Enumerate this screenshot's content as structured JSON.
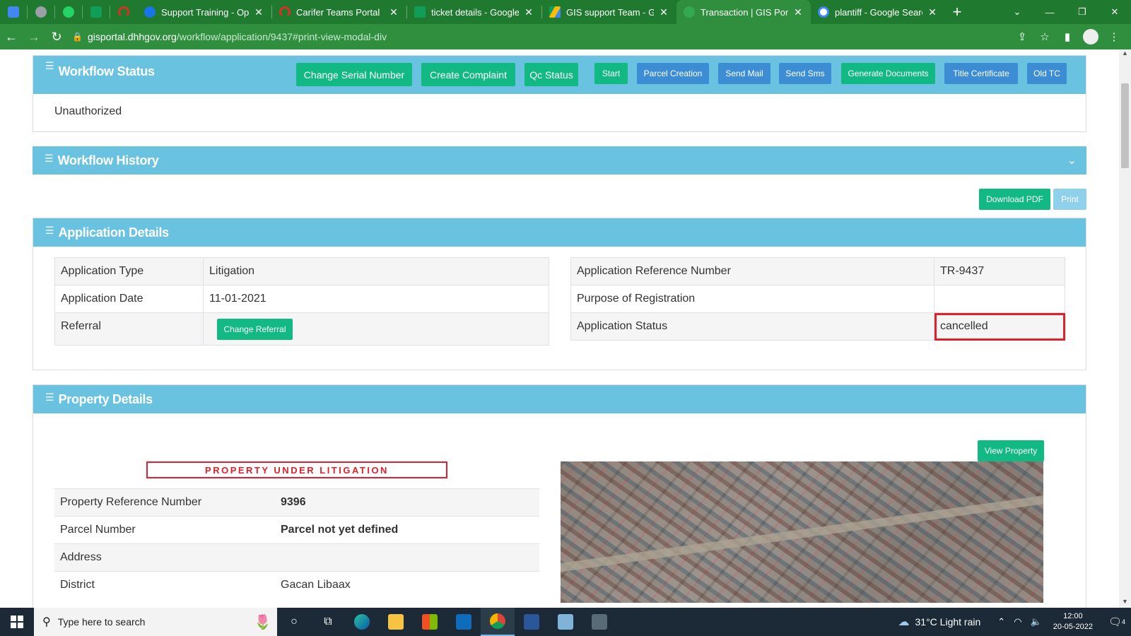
{
  "browser": {
    "pinned_tabs": [
      {
        "icon": "docs-icon",
        "color": "#4285f4"
      },
      {
        "icon": "perplexity-icon",
        "color": "#9aa0a6"
      },
      {
        "icon": "whatsapp-icon",
        "color": "#25d366"
      },
      {
        "icon": "sheets-icon",
        "color": "#0f9d58"
      },
      {
        "icon": "red-arc-icon",
        "color": "#d93025"
      }
    ],
    "tabs": [
      {
        "title": "Support Training - Ope",
        "icon_color": "#1a73e8",
        "active": false
      },
      {
        "title": "Carifer Teams Portal",
        "icon_color": "#d93025",
        "active": false
      },
      {
        "title": "ticket details - Google S",
        "icon_color": "#0f9d58",
        "active": false
      },
      {
        "title": "GIS support Team - Go",
        "icon_color": "#fbbc04",
        "active": false
      },
      {
        "title": "Transaction | GIS Portal",
        "icon_color": "#34a853",
        "active": true
      },
      {
        "title": "plantiff - Google Search",
        "icon_color": "#4285f4",
        "active": false
      }
    ],
    "close_glyph": "✕",
    "new_tab": "+",
    "url_host": "gisportal.dhhgov.org",
    "url_path": "/workflow/application/9437#print-view-modal-div"
  },
  "workflow_status": {
    "title": "Workflow Status",
    "status": "Unauthorized",
    "buttons": [
      {
        "label": "Change Serial Number",
        "color": "green"
      },
      {
        "label": "Create Complaint",
        "color": "green"
      },
      {
        "label": "Qc Status",
        "color": "green"
      },
      {
        "label": "Start",
        "color": "green"
      },
      {
        "label": "Parcel Creation",
        "color": "blue"
      },
      {
        "label": "Send Mail",
        "color": "blue"
      },
      {
        "label": "Send Sms",
        "color": "blue"
      },
      {
        "label": "Generate Documents",
        "color": "green"
      },
      {
        "label": "Title Certificate",
        "color": "blue"
      },
      {
        "label": "Old TC",
        "color": "blue"
      }
    ]
  },
  "workflow_history": {
    "title": "Workflow History"
  },
  "toolbar": {
    "download_pdf": "Download PDF",
    "print": "Print"
  },
  "application_details": {
    "title": "Application Details",
    "left": [
      {
        "label": "Application Type",
        "value": "Litigation"
      },
      {
        "label": "Application Date",
        "value": "11-01-2021"
      },
      {
        "label": "Referral",
        "button": "Change Referral"
      }
    ],
    "right": [
      {
        "label": "Application Reference Number",
        "value": "TR-9437"
      },
      {
        "label": "Purpose of Registration",
        "value": ""
      },
      {
        "label": "Application Status",
        "value": "cancelled"
      }
    ]
  },
  "property_details": {
    "title": "Property Details",
    "view_property": "View Property",
    "litigation_banner": "PROPERTY UNDER LITIGATION",
    "rows": [
      {
        "label": "Property Reference Number",
        "value": "9396"
      },
      {
        "label": "Parcel Number",
        "value": "Parcel not yet defined"
      },
      {
        "label": "Address",
        "value": ""
      },
      {
        "label": "District",
        "value": "Gacan Libaax"
      }
    ]
  },
  "taskbar": {
    "search_placeholder": "Type here to search",
    "weather": "31°C  Light rain",
    "time": "12:00",
    "date": "20-05-2022",
    "notification_count": "4"
  },
  "colors": {
    "accent_green": "#13b983",
    "accent_blue": "#3c8dd3",
    "panel_header": "#69c3e0",
    "highlight_red": "#e0202a",
    "browser_green": "#2f8f3e"
  }
}
